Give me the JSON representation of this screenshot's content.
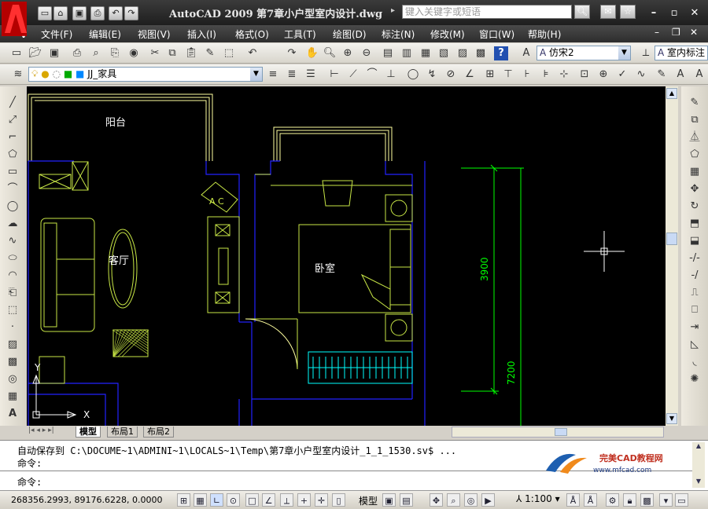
{
  "title": "AutoCAD 2009  第7章小户型室内设计.dwg",
  "search": {
    "placeholder": "键入关键字或短语"
  },
  "menu": [
    "文件(F)",
    "编辑(E)",
    "视图(V)",
    "插入(I)",
    "格式(O)",
    "工具(T)",
    "绘图(D)",
    "标注(N)",
    "修改(M)",
    "窗口(W)",
    "帮助(H)"
  ],
  "toolbar": {
    "text_style": "仿宋2",
    "dim_style": "室内标注",
    "layer": "JJ_家具"
  },
  "drawing": {
    "labels": {
      "balcony": "阳台",
      "living": "客厅",
      "bedroom": "卧室",
      "ac": "A C"
    },
    "dimensions": {
      "dim1": "3900",
      "dim2": "7200"
    },
    "ucs": {
      "x": "X",
      "y": "Y"
    }
  },
  "layout_tabs": [
    "模型",
    "布局1",
    "布局2"
  ],
  "command": {
    "history": "自动保存到 C:\\DOCUME~1\\ADMINI~1\\LOCALS~1\\Temp\\第7章小户型室内设计_1_1_1530.sv$ ...",
    "line2": "命令:",
    "prompt": "命令:"
  },
  "watermark": {
    "text": "完美CAD教程网",
    "url": "www.mfcad.com"
  },
  "status": {
    "coords": "268356.2993, 89176.6228, 0.0000",
    "model": "模型",
    "scale": "1:100"
  },
  "colors": {
    "canvas": "#000000",
    "walls": "#2222ff",
    "furniture": "#c8e646",
    "text": "#ffffff",
    "dims": "#00ff00",
    "balcony": "#ffffa0"
  }
}
